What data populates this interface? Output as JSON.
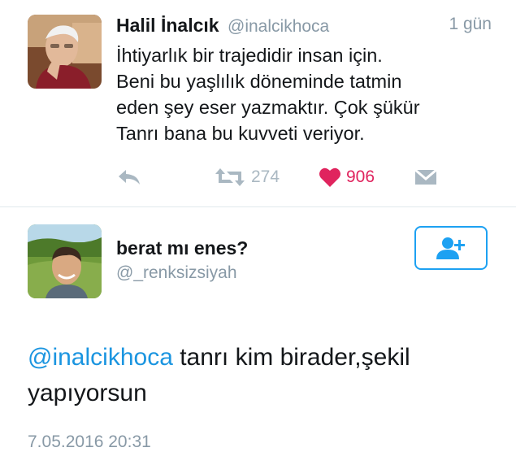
{
  "tweet": {
    "author_name": "Halil İnalcık",
    "author_handle": "@inalcikhoca",
    "time_ago": "1 gün",
    "text_lines": [
      "İhtiyarlık bir trajedidir insan için.",
      "Beni bu yaşlılık döneminde tatmin",
      "eden şey eser yazmaktır. Çok şükür",
      "Tanrı bana bu kuvveti veriyor."
    ],
    "retweet_count": "274",
    "like_count": "906",
    "icons": {
      "reply": "reply-icon",
      "retweet": "retweet-icon",
      "like": "heart-icon",
      "dm": "envelope-icon"
    }
  },
  "reply": {
    "author_name": "berat mı enes?",
    "author_handle": "@_renksizsiyah",
    "follow_icon": "add-user-icon",
    "mention": "@inalcikhoca",
    "text_rest_line1": " tanrı kim birader,şekil",
    "text_line2": "yapıyorsun",
    "timestamp": "7.05.2016 20:31"
  },
  "colors": {
    "accent": "#1da1f2",
    "like": "#e0245e",
    "muted": "#8899a6",
    "text": "#14171a"
  }
}
